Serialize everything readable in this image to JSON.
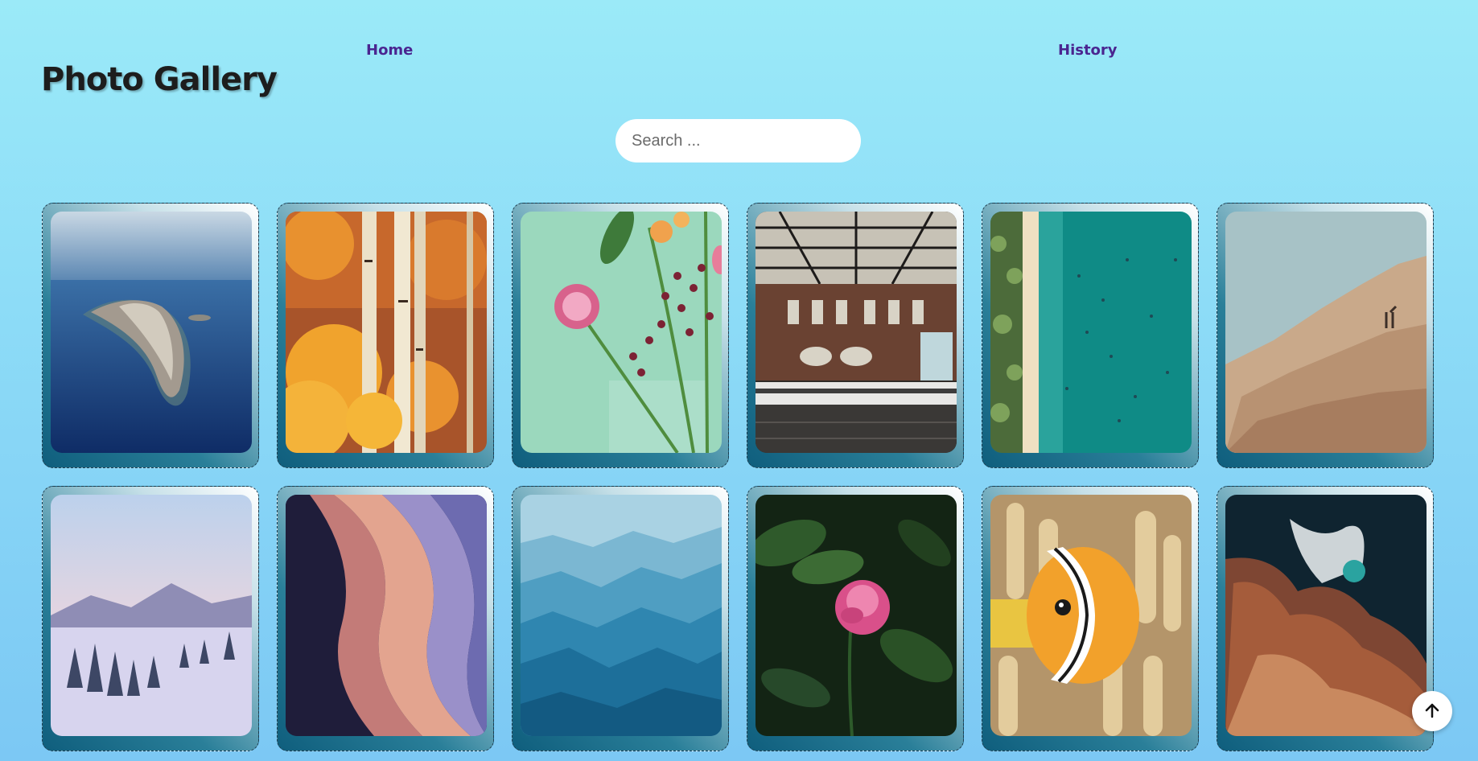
{
  "nav": {
    "home": "Home",
    "history": "History"
  },
  "header": {
    "title": "Photo Gallery"
  },
  "search": {
    "placeholder": "Search ..."
  },
  "gallery": {
    "photos": [
      {
        "subject": "island-aerial"
      },
      {
        "subject": "autumn-birch-forest"
      },
      {
        "subject": "flowers-in-vase"
      },
      {
        "subject": "train-station"
      },
      {
        "subject": "beach-aerial"
      },
      {
        "subject": "rocky-mountain-with-goats"
      },
      {
        "subject": "snowy-landscape"
      },
      {
        "subject": "slot-canyon"
      },
      {
        "subject": "blue-mountain-ridges"
      },
      {
        "subject": "pink-peony"
      },
      {
        "subject": "clownfish-anemone"
      },
      {
        "subject": "rocky-coastline-aerial"
      }
    ]
  },
  "controls": {
    "scroll_top_icon": "arrow-up-icon"
  }
}
